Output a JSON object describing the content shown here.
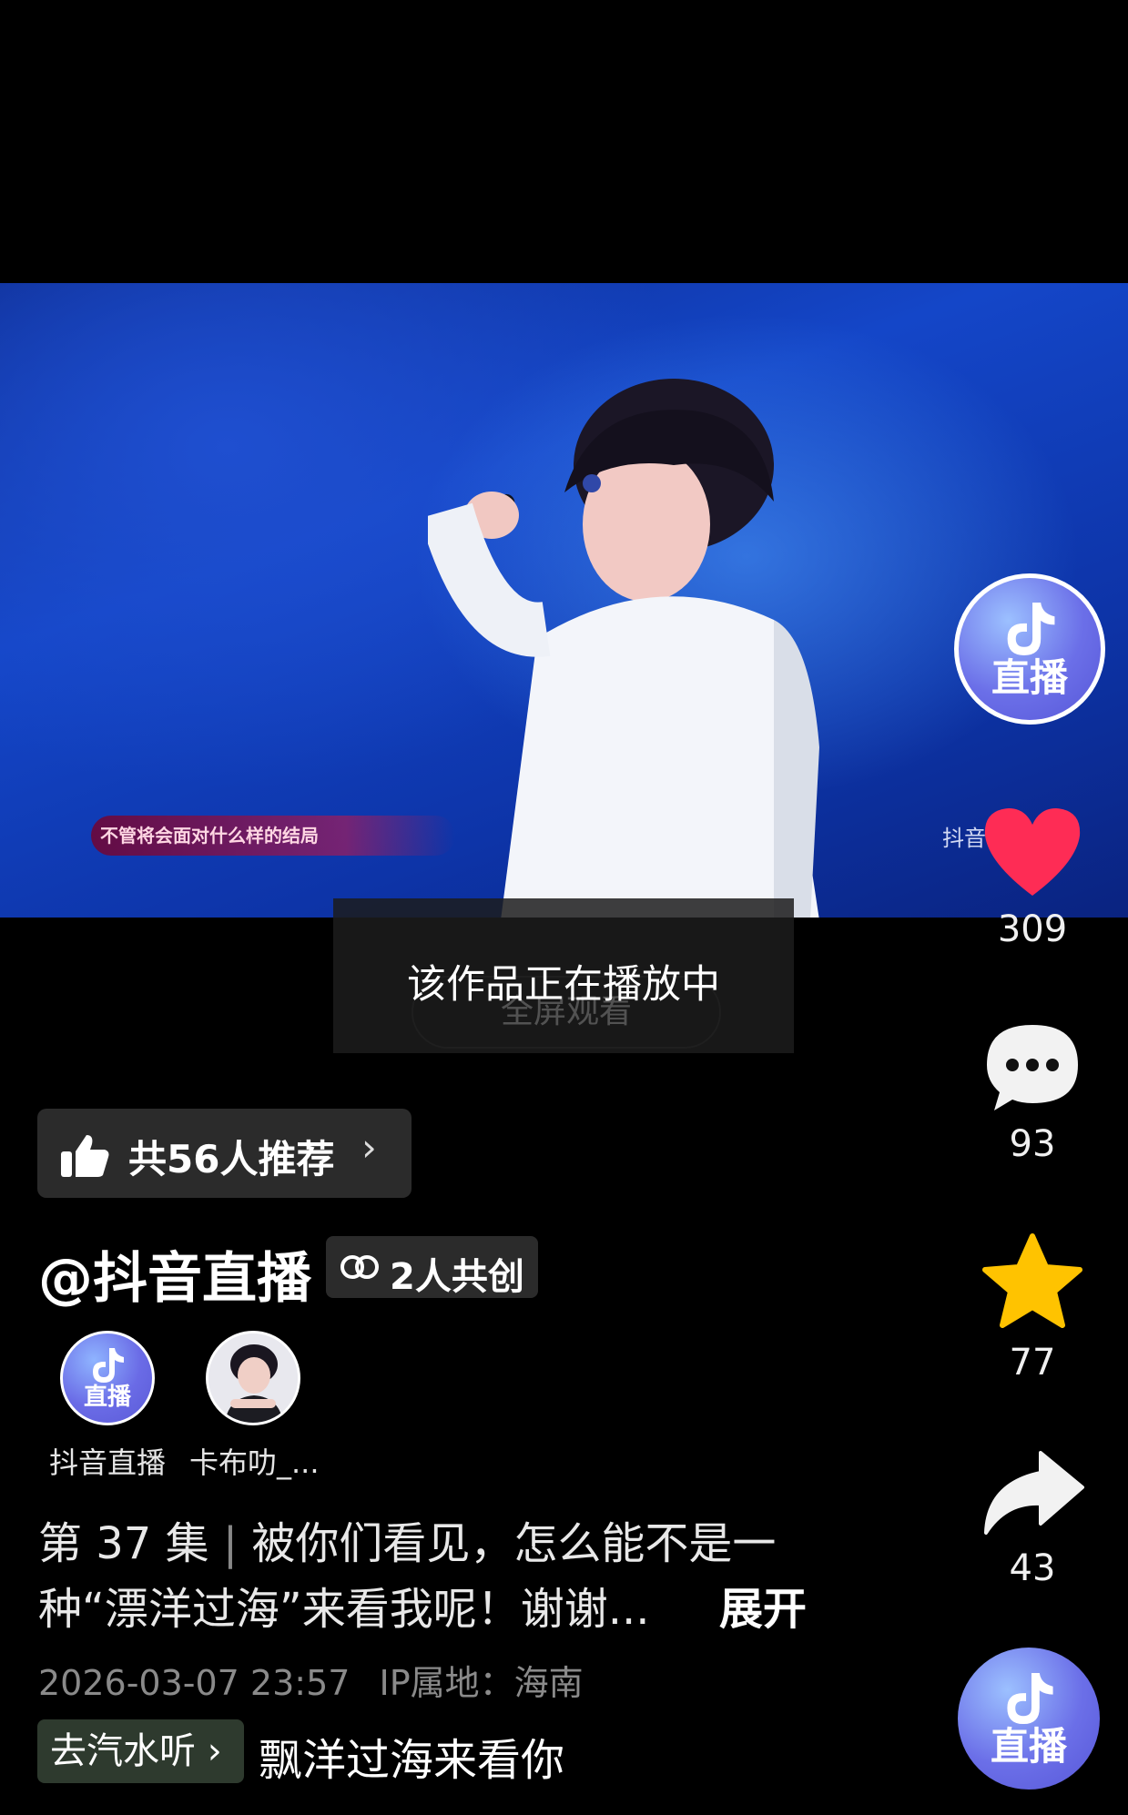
{
  "video": {
    "lyric_caption": "不管将会面对什么样的结局",
    "watermark": "抖音"
  },
  "overlay": {
    "playing_message": "该作品正在播放中",
    "fullscreen_label": "全屏观看"
  },
  "recommend": {
    "label": "共56人推荐",
    "chevron": "›"
  },
  "author": {
    "handle": "@抖音直播",
    "cocreate_label": "2人共创"
  },
  "creators": [
    {
      "name": "抖音直播",
      "badge": "直播"
    },
    {
      "name": "卡布叻_..."
    }
  ],
  "description": {
    "episode": "第 37 集",
    "separator": "|",
    "text": "被你们看见，怎么能不是一种“漂洋过海”来看我呢！谢谢...",
    "line1": "被你们看见，怎么能不是一",
    "line2": "种“漂洋过海”来看我呢！谢谢...",
    "expand": "展开"
  },
  "meta": {
    "datetime": "2026-03-07 23:57",
    "ip_location": "IP属地：海南"
  },
  "music": {
    "tag": "去汽水听",
    "chevron": "›",
    "title": "飘洋过海来看你"
  },
  "rail": {
    "live_badge": "直播",
    "likes": "309",
    "comments": "93",
    "favorites": "77",
    "shares": "43"
  },
  "colors": {
    "like": "#fe2c55",
    "favorite": "#ffc300",
    "live_avatar": "#6b6fe8"
  }
}
